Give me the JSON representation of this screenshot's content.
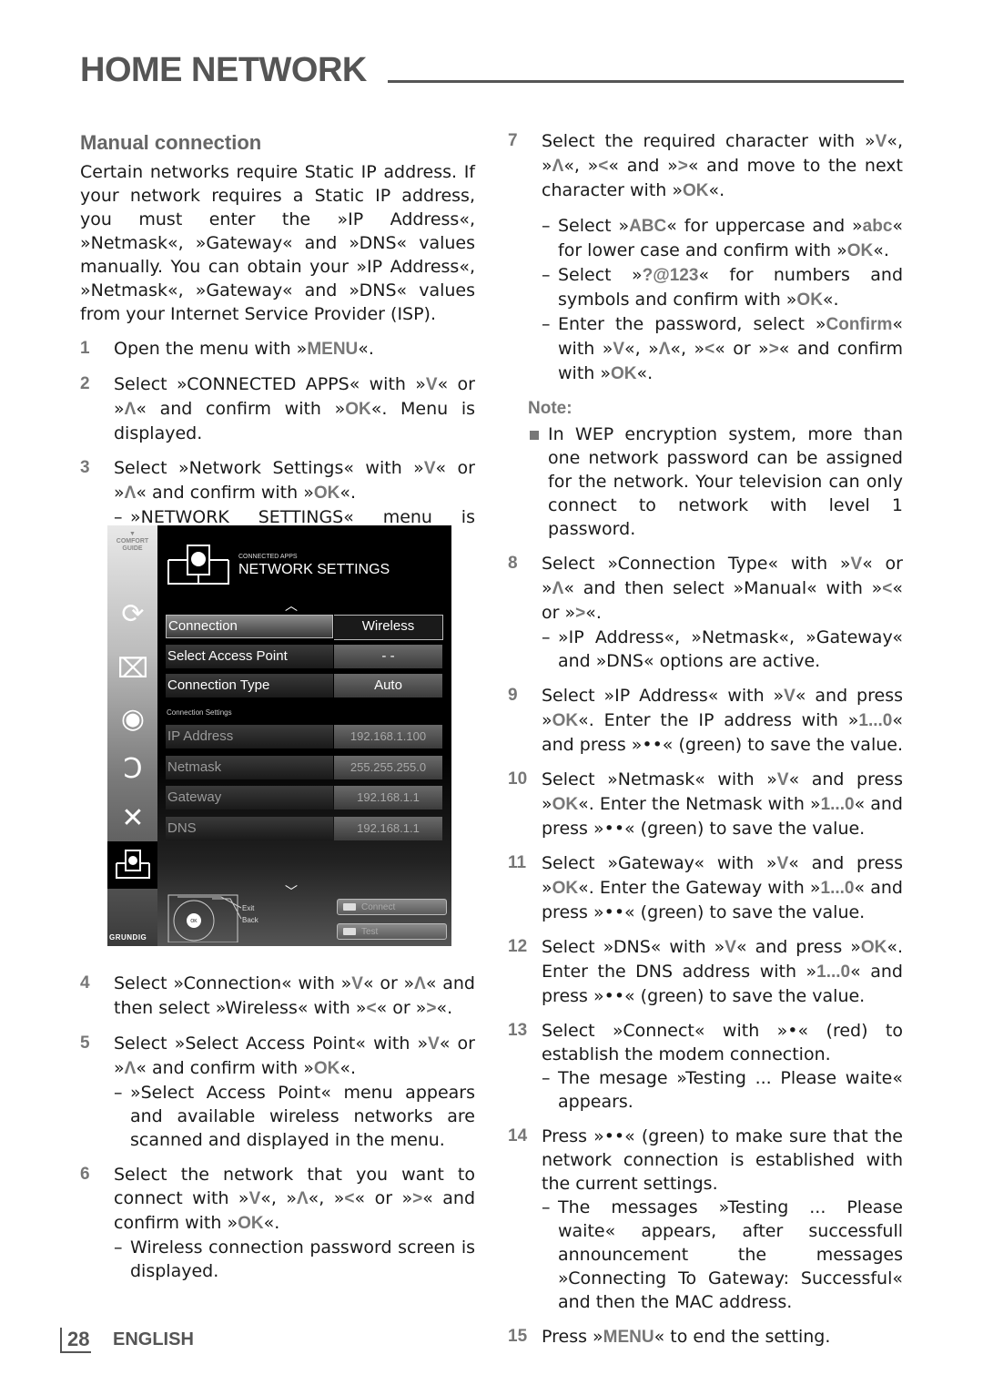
{
  "header": {
    "title": "HOME NETWORK"
  },
  "section": {
    "title": "Manual connection",
    "intro": "Certain networks require Static IP address. If your network requires a Static IP address, you must enter the »IP Address«, »Netmask«, »Gateway« and »DNS« values manually. You can obtain your »IP Address«, »Netmask«, »Gateway« and »DNS« values from your Internet Service Provider (ISP)."
  },
  "steps": {
    "s1": {
      "num": "1",
      "text_a": "Open the menu with »",
      "key": "MENU",
      "text_b": "«."
    },
    "s2": {
      "num": "2",
      "text_a": "Select »CONNECTED APPS« with »",
      "k1": "V",
      "text_b": "« or »",
      "k2": "Λ",
      "text_c": "« and confirm with »",
      "k3": "OK",
      "text_d": "«. Menu is displayed."
    },
    "s3": {
      "num": "3",
      "text_a": "Select »Network Settings« with »",
      "k1": "V",
      "text_b": "« or »",
      "k2": "Λ",
      "text_c": "« and confirm with »",
      "k3": "OK",
      "text_d": "«.",
      "sub": "»NETWORK SETTINGS« menu is displayed."
    },
    "s4": {
      "num": "4",
      "text_a": "Select »Connection« with »",
      "k1": "V",
      "text_b": "« or »",
      "k2": "Λ",
      "text_c": "« and then select »Wireless« with »",
      "k3": "<",
      "text_d": "« or »",
      "k4": ">",
      "text_e": "«."
    },
    "s5": {
      "num": "5",
      "text_a": "Select »Select Access Point« with »",
      "k1": "V",
      "text_b": "« or »",
      "k2": "Λ",
      "text_c": "« and confirm with »",
      "k3": "OK",
      "text_d": "«.",
      "sub": "»Select Access Point« menu appears and available wireless networks are scanned and displayed in the menu."
    },
    "s6": {
      "num": "6",
      "text_a": "Select the network that you want to connect with »",
      "k1": "V",
      "text_b": "«, »",
      "k2": "Λ",
      "text_c": "«, »",
      "k3": "<",
      "text_d": "« or »",
      "k4": ">",
      "text_e": "« and confirm with »",
      "k5": "OK",
      "text_f": "«.",
      "sub": "Wireless connection password screen is displayed."
    },
    "s7": {
      "num": "7",
      "text_a": "Select the required character with »",
      "k1": "V",
      "text_b": "«, »",
      "k2": "Λ",
      "text_c": "«, »",
      "k3": "<",
      "text_d": "« and »",
      "k4": ">",
      "text_e": "« and move to the next character with »",
      "k5": "OK",
      "text_f": "«.",
      "sub1": {
        "a": "Select »",
        "k1": "ABC",
        "b": "« for uppercase and »",
        "k2": "abc",
        "c": "« for lower case and confirm with »",
        "k3": "OK",
        "d": "«."
      },
      "sub2": {
        "a": "Select »",
        "k1": "?@123",
        "b": "« for numbers and symbols and confirm with »",
        "k2": "OK",
        "c": "«."
      },
      "sub3": {
        "a": "Enter the password, select »",
        "k1": "Confirm",
        "b": "« with »",
        "k2": "V",
        "c": "«, »",
        "k3": "Λ",
        "d": "«, »",
        "k4": "<",
        "e": "« or »",
        "k5": ">",
        "f": "« and confirm with »",
        "k6": "OK",
        "g": "«."
      }
    },
    "note": {
      "title": "Note:",
      "text": "In WEP encryption system, more than one network password can be assigned for the network. Your television can only connect to network with level 1 password."
    },
    "s8": {
      "num": "8",
      "text_a": "Select »Connection Type« with »",
      "k1": "V",
      "text_b": "« or »",
      "k2": "Λ",
      "text_c": "« and then select »Manual« with »",
      "k3": "<",
      "text_d": "« or »",
      "k4": ">",
      "text_e": "«.",
      "sub": "»IP Address«, »Netmask«, »Gateway« and »DNS« options are active."
    },
    "s9": {
      "num": "9",
      "text_a": "Select »IP Address« with »",
      "k1": "V",
      "text_b": "« and press »",
      "k2": "OK",
      "text_c": "«. Enter the IP address with »",
      "k3": "1...0",
      "text_d": "« and press »••« (green) to save the value."
    },
    "s10": {
      "num": "10",
      "text_a": "Select »Netmask« with »",
      "k1": "V",
      "text_b": "« and press »",
      "k2": "OK",
      "text_c": "«. Enter the Netmask with »",
      "k3": "1...0",
      "text_d": "« and press »••« (green) to save the value."
    },
    "s11": {
      "num": "11",
      "text_a": "Select »Gateway« with »",
      "k1": "V",
      "text_b": "« and press »",
      "k2": "OK",
      "text_c": "«. Enter the Gateway with »",
      "k3": "1...0",
      "text_d": "« and press »••« (green) to save the value."
    },
    "s12": {
      "num": "12",
      "text_a": "Select »DNS« with »",
      "k1": "V",
      "text_b": "« and press »",
      "k2": "OK",
      "text_c": "«. Enter the DNS address with »",
      "k3": "1...0",
      "text_d": "« and press »••« (green) to save the value."
    },
    "s13": {
      "num": "13",
      "text": "Select »Connect« with »•« (red) to establish the modem connection.",
      "sub": "The mesage »Testing ... Please waite« appears."
    },
    "s14": {
      "num": "14",
      "text": "Press »••« (green) to make sure that the network connection is established with the current settings.",
      "sub": "The messages »Testing ... Please waite« appears, after successfull announcement the messages »Connecting To Gateway: Successful« and then the MAC address."
    },
    "s15": {
      "num": "15",
      "text_a": "Press »",
      "key": "MENU",
      "text_b": "« to end the setting."
    }
  },
  "tv_screen": {
    "comfort_guide": "COMFORT GUIDE",
    "breadcrumb": "CONNECTED APPS",
    "title": "NETWORK SETTINGS",
    "rows": [
      {
        "label": "Connection",
        "value": "Wireless"
      },
      {
        "label": "Select Access Point",
        "value": "- -"
      },
      {
        "label": "Connection Type",
        "value": "Auto"
      }
    ],
    "section_label": "Connection Settings",
    "settings": [
      {
        "label": "IP Address",
        "value": "192.168.1.100"
      },
      {
        "label": "Netmask",
        "value": "255.255.255.0"
      },
      {
        "label": "Gateway",
        "value": "192.168.1.1"
      },
      {
        "label": "DNS",
        "value": "192.168.1.1"
      }
    ],
    "exit_label": "Exit",
    "back_label": "Back",
    "ok_label": "OK",
    "connect_button": "Connect",
    "test_button": "Test",
    "brand": "GRUNDIG"
  },
  "footer": {
    "page": "28",
    "language": "ENGLISH"
  }
}
